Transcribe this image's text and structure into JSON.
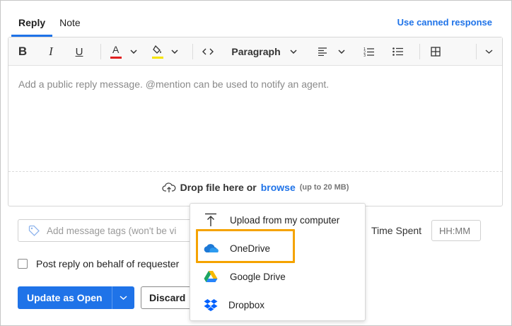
{
  "tabs": [
    {
      "label": "Reply",
      "active": true
    },
    {
      "label": "Note",
      "active": false
    }
  ],
  "canned_response_label": "Use canned response",
  "toolbar": {
    "bold_label": "B",
    "italic_label": "I",
    "underline_label": "U",
    "font_color_letter": "A",
    "font_color": "#e02020",
    "highlight_color": "#f5e400",
    "paragraph_label": "Paragraph"
  },
  "editor": {
    "placeholder": "Add a public reply message. @mention can be used to notify an agent."
  },
  "dropzone": {
    "text": "Drop file here or",
    "browse": "browse",
    "limit": "(up to 20 MB)"
  },
  "tags": {
    "placeholder": "Add message tags (won't be vi"
  },
  "time_spent": {
    "label": "Time Spent",
    "placeholder": "HH:MM"
  },
  "behalf_checkbox": {
    "label": "Post reply on behalf of requester",
    "checked": false
  },
  "buttons": {
    "update": "Update as Open",
    "discard": "Discard"
  },
  "upload_menu": {
    "items": [
      {
        "label": "Upload from my computer",
        "icon": "upload-icon"
      },
      {
        "label": "OneDrive",
        "icon": "onedrive-icon",
        "highlighted": true
      },
      {
        "label": "Google Drive",
        "icon": "google-drive-icon"
      },
      {
        "label": "Dropbox",
        "icon": "dropbox-icon"
      }
    ]
  },
  "colors": {
    "accent": "#1f73e8",
    "highlight_outline": "#f5a300"
  }
}
